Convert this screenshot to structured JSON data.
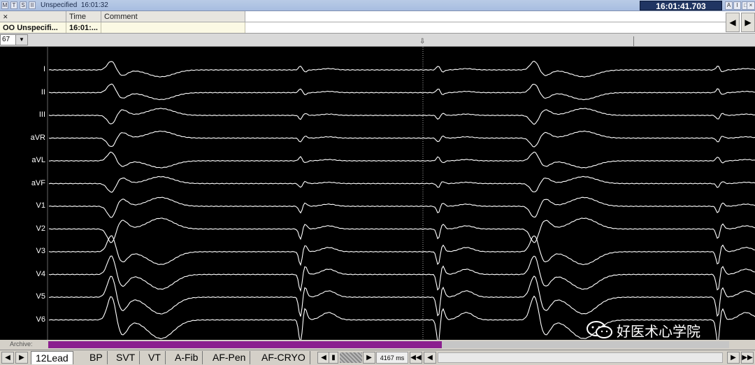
{
  "titlebar": {
    "buttons": [
      "M",
      "T",
      "S",
      "II"
    ],
    "title": "Unspecified",
    "time": "16:01:32",
    "clock": "16:01:41.703",
    "window_buttons": [
      "A",
      "I",
      "□",
      "+",
      "×"
    ]
  },
  "annotation_table": {
    "headers": [
      "",
      "Time",
      "Comment"
    ],
    "row": {
      "marker": "OO",
      "name": "Unspecifi...",
      "time": "16:01:...",
      "comment": ""
    }
  },
  "ruler": {
    "speed_value": "67"
  },
  "leads": [
    "I",
    "II",
    "III",
    "aVR",
    "aVL",
    "aVF",
    "V1",
    "V2",
    "V3",
    "V4",
    "V5",
    "V6"
  ],
  "archive": {
    "label": "Archive:",
    "progress_fraction": 0.578
  },
  "tabs": [
    "12Lead",
    "BP",
    "SVT",
    "VT",
    "A-Fib",
    "AF-Pen",
    "AF-CRYO"
  ],
  "active_tab": "12Lead",
  "duration": "4167 ms",
  "watermark": {
    "text": "好医术心学院",
    "icon": "wechat-icon"
  },
  "colors": {
    "trace": "#ffffff",
    "background": "#000000",
    "archive_bar": "#8b1f8f",
    "clock_bg": "#203562"
  }
}
